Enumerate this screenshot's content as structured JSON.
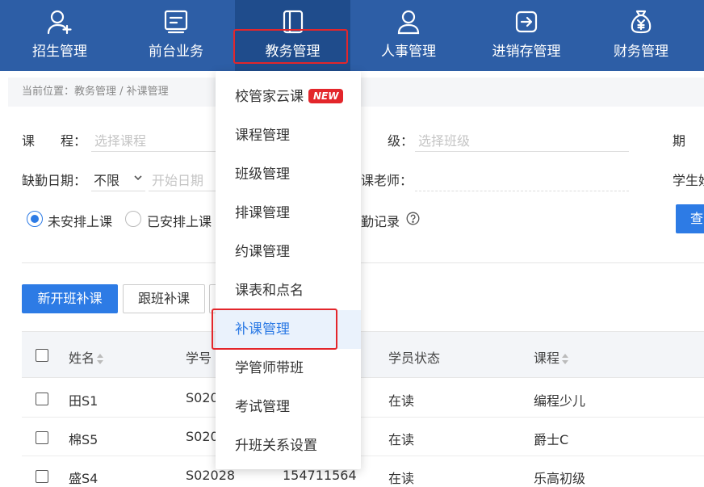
{
  "nav": {
    "items": [
      {
        "label": "招生管理",
        "icon": "user-add-icon"
      },
      {
        "label": "前台业务",
        "icon": "screen-icon"
      },
      {
        "label": "教务管理",
        "icon": "book-icon"
      },
      {
        "label": "人事管理",
        "icon": "person-icon"
      },
      {
        "label": "进销存管理",
        "icon": "exchange-icon"
      },
      {
        "label": "财务管理",
        "icon": "money-bag-icon"
      }
    ],
    "active_index": 2
  },
  "breadcrumb": "当前位置：教务管理 / 补课管理",
  "filters": {
    "course_label": "课　　程：",
    "course_placeholder": "选择课程",
    "class_label": "级：",
    "class_placeholder": "选择班级",
    "period_label": "期",
    "absence_date_label": "缺勤日期：",
    "absence_date_value": "不限",
    "start_date_placeholder": "开始日期",
    "teacher_label": "课老师：",
    "student_label": "学生姓",
    "radio_unarranged": "未安排上课",
    "radio_arranged": "已安排上课",
    "absence_record_label": "勤记录",
    "search_button": "查"
  },
  "actions": {
    "new_class_makeup": "新开班补课",
    "follow_class_makeup": "跟班补课"
  },
  "table": {
    "headers": [
      "姓名",
      "学号",
      "学员状态",
      "课程"
    ],
    "rows": [
      {
        "name": "田S1",
        "id": "S020",
        "phone": "",
        "status": "在读",
        "course": "编程少儿"
      },
      {
        "name": "棉S5",
        "id": "S020",
        "phone": "",
        "status": "在读",
        "course": "爵士C"
      },
      {
        "name": "盛S4",
        "id": "S02028",
        "phone": "154711564",
        "status": "在读",
        "course": "乐高初级"
      }
    ]
  },
  "dropdown": {
    "items": [
      {
        "label": "校管家云课",
        "badge": "NEW"
      },
      {
        "label": "课程管理"
      },
      {
        "label": "班级管理"
      },
      {
        "label": "排课管理"
      },
      {
        "label": "约课管理"
      },
      {
        "label": "课表和点名"
      },
      {
        "label": "补课管理"
      },
      {
        "label": "学管师带班"
      },
      {
        "label": "考试管理"
      },
      {
        "label": "升班关系设置"
      }
    ],
    "active_index": 6
  },
  "colors": {
    "nav_bg": "#2d5ea6",
    "accent": "#2d7be5",
    "highlight_box": "#e3262b"
  }
}
